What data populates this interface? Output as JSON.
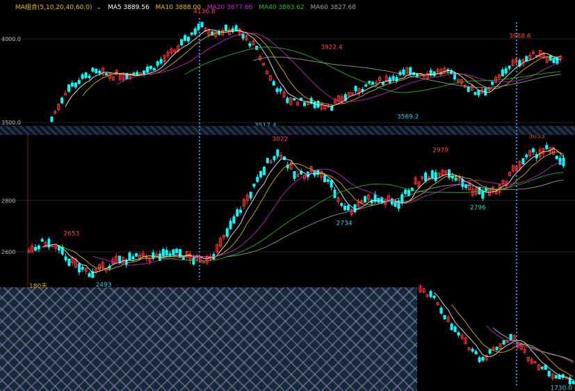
{
  "legend": {
    "group": "MA组合(5,10,20,40,60,0)",
    "items": [
      {
        "label": "MA5 3889.56",
        "color": "#ffffff"
      },
      {
        "label": "MA10 3888.00",
        "color": "#e8c000"
      },
      {
        "label": "MA20 3877.66",
        "color": "#d020d0"
      },
      {
        "label": "MA40 3883.62",
        "color": "#20c020"
      },
      {
        "label": "MA60 3827.68",
        "color": "#a0a0a0"
      }
    ]
  },
  "period_label": "180天",
  "colors": {
    "up": "#ff3030",
    "down": "#00ffff",
    "grid": "#3a3a3a",
    "marker": "#3a8fd0"
  },
  "chart_data": [
    {
      "type": "candlestick",
      "ylim": [
        3500,
        4200
      ],
      "yticks": [
        {
          "v": 4000,
          "label": "4000.0"
        },
        {
          "v": 3500,
          "label": "3500.0"
        }
      ],
      "annotations": [
        {
          "x": 0.3,
          "y": 4136.8,
          "label": "4136.8",
          "kind": "high"
        },
        {
          "x": 0.55,
          "y": 3922.4,
          "label": "3922.4",
          "kind": "high"
        },
        {
          "x": 0.92,
          "y": 3988.6,
          "label": "3988.6",
          "kind": "high"
        },
        {
          "x": 0.42,
          "y": 3517.4,
          "label": "3517.4",
          "kind": "low"
        },
        {
          "x": 0.7,
          "y": 3569.2,
          "label": "3569.2",
          "kind": "low"
        }
      ],
      "x_start": 0.09,
      "x_end": 0.975,
      "anchors": [
        [
          0,
          3520
        ],
        [
          0.03,
          3700
        ],
        [
          0.08,
          3800
        ],
        [
          0.12,
          3780
        ],
        [
          0.16,
          3790
        ],
        [
          0.2,
          3830
        ],
        [
          0.25,
          3950
        ],
        [
          0.29,
          4080
        ],
        [
          0.32,
          4040
        ],
        [
          0.36,
          4060
        ],
        [
          0.4,
          3950
        ],
        [
          0.43,
          3760
        ],
        [
          0.46,
          3640
        ],
        [
          0.5,
          3620
        ],
        [
          0.55,
          3600
        ],
        [
          0.58,
          3660
        ],
        [
          0.62,
          3720
        ],
        [
          0.66,
          3760
        ],
        [
          0.7,
          3800
        ],
        [
          0.73,
          3790
        ],
        [
          0.77,
          3810
        ],
        [
          0.8,
          3760
        ],
        [
          0.83,
          3680
        ],
        [
          0.86,
          3700
        ],
        [
          0.9,
          3840
        ],
        [
          0.93,
          3880
        ],
        [
          0.96,
          3920
        ],
        [
          0.98,
          3880
        ],
        [
          1.0,
          3880
        ]
      ]
    },
    {
      "type": "candlestick",
      "ylim": [
        2480,
        3040
      ],
      "yticks": [
        {
          "v": 2800,
          "label": "2800"
        },
        {
          "v": 2600,
          "label": "2600"
        }
      ],
      "annotations": [
        {
          "x": 0.08,
          "y": 2653,
          "label": "2653",
          "kind": "high"
        },
        {
          "x": 0.47,
          "y": 3022,
          "label": "3022",
          "kind": "high"
        },
        {
          "x": 0.77,
          "y": 2979,
          "label": "2979",
          "kind": "high"
        },
        {
          "x": 0.95,
          "y": 3033,
          "label": "3033",
          "kind": "high"
        },
        {
          "x": 0.14,
          "y": 2493,
          "label": "2493",
          "kind": "low"
        },
        {
          "x": 0.59,
          "y": 2734,
          "label": "2734",
          "kind": "low"
        },
        {
          "x": 0.84,
          "y": 2796,
          "label": "2796",
          "kind": "low"
        }
      ],
      "x_start": 0.05,
      "x_end": 0.98,
      "anchors": [
        [
          0,
          2590
        ],
        [
          0.03,
          2640
        ],
        [
          0.06,
          2600
        ],
        [
          0.09,
          2540
        ],
        [
          0.12,
          2515
        ],
        [
          0.16,
          2560
        ],
        [
          0.2,
          2575
        ],
        [
          0.24,
          2580
        ],
        [
          0.28,
          2595
        ],
        [
          0.32,
          2560
        ],
        [
          0.35,
          2600
        ],
        [
          0.37,
          2670
        ],
        [
          0.4,
          2780
        ],
        [
          0.43,
          2880
        ],
        [
          0.45,
          2960
        ],
        [
          0.47,
          2990
        ],
        [
          0.5,
          2890
        ],
        [
          0.53,
          2920
        ],
        [
          0.56,
          2880
        ],
        [
          0.58,
          2800
        ],
        [
          0.6,
          2760
        ],
        [
          0.63,
          2810
        ],
        [
          0.66,
          2800
        ],
        [
          0.69,
          2790
        ],
        [
          0.72,
          2860
        ],
        [
          0.75,
          2900
        ],
        [
          0.78,
          2920
        ],
        [
          0.81,
          2870
        ],
        [
          0.84,
          2830
        ],
        [
          0.88,
          2840
        ],
        [
          0.91,
          2930
        ],
        [
          0.94,
          2980
        ],
        [
          0.97,
          3000
        ],
        [
          1.0,
          2950
        ]
      ]
    },
    {
      "type": "candlestick",
      "ylim": [
        1700,
        2300
      ],
      "yticks": [],
      "annotations": [
        {
          "x": 0.92,
          "y": 1730.0,
          "label": "1730.0",
          "kind": "low"
        }
      ],
      "x_start": 0.02,
      "x_end": 0.99,
      "anchors": [
        [
          0,
          2250
        ],
        [
          0.1,
          2200
        ],
        [
          0.2,
          2050
        ],
        [
          0.3,
          1950
        ],
        [
          0.4,
          1860
        ],
        [
          0.5,
          1930
        ],
        [
          0.6,
          1990
        ],
        [
          0.7,
          1880
        ],
        [
          0.8,
          1810
        ],
        [
          0.9,
          1760
        ],
        [
          1.0,
          1740
        ]
      ]
    }
  ]
}
